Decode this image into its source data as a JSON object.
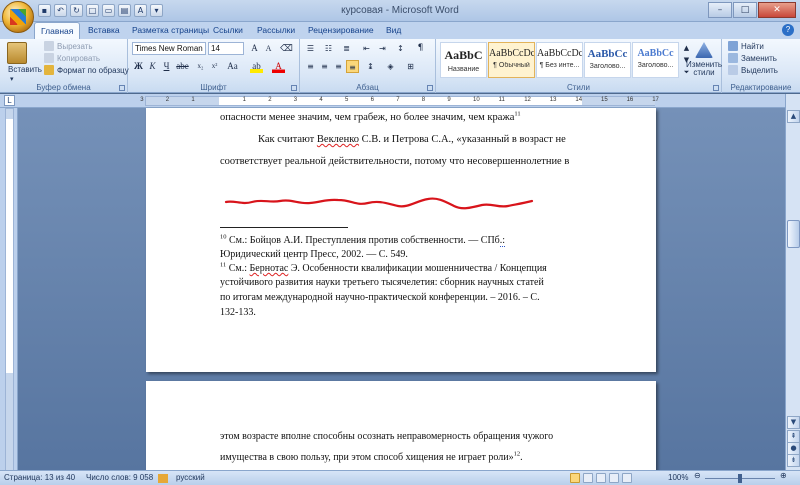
{
  "window": {
    "title": "курсовая - Microsoft Word"
  },
  "tabs": [
    {
      "label": "Главная"
    },
    {
      "label": "Вставка"
    },
    {
      "label": "Разметка страницы"
    },
    {
      "label": "Ссылки"
    },
    {
      "label": "Рассылки"
    },
    {
      "label": "Рецензирование"
    },
    {
      "label": "Вид"
    }
  ],
  "ribbon": {
    "clipboard": {
      "label": "Буфер обмена",
      "paste": "Вставить",
      "cut": "Вырезать",
      "copy": "Копировать",
      "format_painter": "Формат по образцу"
    },
    "font": {
      "label": "Шрифт",
      "font_name": "Times New Roman",
      "font_size": "14"
    },
    "paragraph": {
      "label": "Абзац"
    },
    "styles": {
      "label": "Стили",
      "items": [
        {
          "sample": "AaBbC",
          "name": "Название"
        },
        {
          "sample": "AaBbCcDc",
          "name": "¶ Обычный"
        },
        {
          "sample": "AaBbCcDc",
          "name": "¶ Без инте..."
        },
        {
          "sample": "AaBbCc",
          "name": "Заголово..."
        },
        {
          "sample": "AaBbCc",
          "name": "Заголово..."
        }
      ],
      "change_styles": "Изменить стили"
    },
    "editing": {
      "label": "Редактирование",
      "find": "Найти",
      "replace": "Заменить",
      "select": "Выделить"
    }
  },
  "ruler": {
    "numbers": [
      "3",
      "2",
      "1",
      "1",
      "2",
      "3",
      "4",
      "5",
      "6",
      "7",
      "8",
      "9",
      "10",
      "11",
      "12",
      "13",
      "14",
      "15",
      "16",
      "17"
    ]
  },
  "document": {
    "page1": {
      "line1_text": "опасности менее значим, чем грабеж, но более значим, чем кража",
      "line1_ref": "11",
      "line2_pre": "Как считают ",
      "line2_name": "Векленко",
      "line2_post": " С.В. и Петрова С.А., «указанный в возраст не",
      "line3_text": "соответствует реальной действительности, потому что несовершеннолетние в",
      "fn10_num": "10",
      "fn10_line1_pre": " См.: Бойцов А.И. Преступления против собственности. — СПб",
      "fn10_line1_dot": ".:",
      "fn10_line2": "Юридический центр Пресс, 2002. — С. 549.",
      "fn11_num": "11",
      "fn11_line1_pre": " См.: ",
      "fn11_line1_name": "Бернотас",
      "fn11_line1_post": " Э. Особенности квалификации мошенничества / Концепция",
      "fn11_line2": "устойчивого развития науки третьего тысячелетия: сборник научных статей",
      "fn11_line3": "по итогам международной научно-практической конференции. – 2016. – С.",
      "fn11_line4": "132-133."
    },
    "page2": {
      "line1_text": "этом возрасте вполне способны осознать неправомерность обращения чужого",
      "line2_text": "имущества в свою пользу, при этом способ хищения не играет роли»",
      "line2_ref": "12",
      "line2_tail": "."
    }
  },
  "status": {
    "page": "Страница: 13 из 40",
    "words": "Число слов: 9 058",
    "language": "русский",
    "zoom": "100%"
  },
  "colors": {
    "ribbon_blue": "#bfd3ee",
    "doc_bg": "#5775a0",
    "annotation_red": "#d8141b"
  }
}
